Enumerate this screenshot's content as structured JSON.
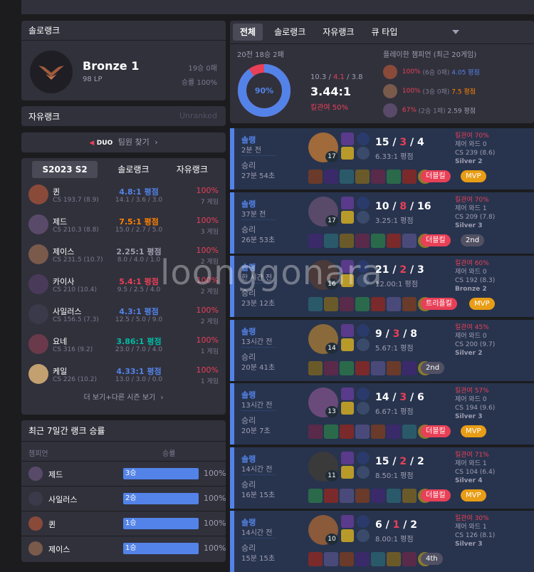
{
  "solo": {
    "title": "솔로랭크",
    "tier": "Bronze 1",
    "lp": "98 LP",
    "record": "19승 0패",
    "winrate": "승률 100%"
  },
  "flex": {
    "title": "자유랭크",
    "status": "Unranked"
  },
  "duo": {
    "badge": "DUO",
    "label": "팀원 찾기"
  },
  "season_tabs": [
    "S2023 S2",
    "솔로랭크",
    "자유랭크"
  ],
  "champions": [
    {
      "name": "퀸",
      "cs": "CS 193.7 (8.9)",
      "kda": "4.8:1 평점",
      "kda_color": "#5383e8",
      "stat": "14.1 / 3.6 / 3.0",
      "wr": "100%",
      "games": "7 게임"
    },
    {
      "name": "제드",
      "cs": "CS 210.3 (8.8)",
      "kda": "7.5:1 평점",
      "kda_color": "#ff8200",
      "stat": "15.0 / 2.7 / 5.0",
      "wr": "100%",
      "games": "3 게임"
    },
    {
      "name": "제이스",
      "cs": "CS 231.5 (10.7)",
      "kda": "2.25:1 평점",
      "kda_color": "#9e9eb1",
      "stat": "8.0 / 4.0 / 1.0",
      "wr": "100%",
      "games": "2 게임"
    },
    {
      "name": "카이사",
      "cs": "CS 210 (10.4)",
      "kda": "5.4:1 평점",
      "kda_color": "#e84057",
      "stat": "9.5 / 2.5 / 4.0",
      "wr": "100%",
      "games": "2 게임"
    },
    {
      "name": "사일러스",
      "cs": "CS 156.5 (7.3)",
      "kda": "4.3:1 평점",
      "kda_color": "#5383e8",
      "stat": "12.5 / 5.0 / 9.0",
      "wr": "100%",
      "games": "2 게임"
    },
    {
      "name": "요네",
      "cs": "CS 316 (9.2)",
      "kda": "3.86:1 평점",
      "kda_color": "#00bba3",
      "stat": "23.0 / 7.0 / 4.0",
      "wr": "100%",
      "games": "1 게임"
    },
    {
      "name": "케일",
      "cs": "CS 226 (10.2)",
      "kda": "4.33:1 평점",
      "kda_color": "#5383e8",
      "stat": "13.0 / 3.0 / 0.0",
      "wr": "100%",
      "games": "1 게임"
    }
  ],
  "more_label": "더 보기+다른 시즌 보기",
  "weekly": {
    "title": "최근 7일간 랭크 승률",
    "col_champ": "챔피언",
    "col_wr": "승률",
    "rows": [
      {
        "name": "제드",
        "wins": "3승",
        "pct": "100%"
      },
      {
        "name": "사일러스",
        "wins": "2승",
        "pct": "100%"
      },
      {
        "name": "퀸",
        "wins": "1승",
        "pct": "100%"
      },
      {
        "name": "제이스",
        "wins": "1승",
        "pct": "100%"
      }
    ]
  },
  "filter_tabs": [
    "전체",
    "솔로랭크",
    "자유랭크",
    "큐 타입"
  ],
  "summary": {
    "record": "20전 18승 2패",
    "donut_label": "90%",
    "win_fraction": 0.9,
    "kda_k": "10.3",
    "kda_d": "4.1",
    "kda_a": "3.8",
    "ratio": "3.44:1",
    "kp": "킬관여 50%",
    "played_title": "플레이한 챔피언 (최근 20게임)",
    "played": [
      {
        "wr": "100%",
        "detail": "(6승 0패)",
        "kda": "4.05 평점",
        "kda_color": "#5383e8"
      },
      {
        "wr": "100%",
        "detail": "(3승 0패)",
        "kda": "7.5 평점",
        "kda_color": "#ff8200"
      },
      {
        "wr": "67%",
        "detail": "(2승 1패)",
        "kda": "2.59 평점",
        "kda_color": "#9e9eb1"
      }
    ]
  },
  "matches": [
    {
      "type": "솔랭",
      "ago": "2분 전",
      "result": "승리",
      "duration": "27분 54초",
      "level": "17",
      "k": "15",
      "d": "3",
      "a": "4",
      "ratio": "6.33:1 평점",
      "kp": "킬관여 70%",
      "wards": "제어 와드 0",
      "cs": "CS 239 (8.6)",
      "rank": "Silver 2",
      "badges": [
        "더블킬",
        "MVP"
      ]
    },
    {
      "type": "솔랭",
      "ago": "37분 전",
      "result": "승리",
      "duration": "26분 53초",
      "level": "17",
      "k": "10",
      "d": "8",
      "a": "16",
      "ratio": "3.25:1 평점",
      "kp": "킬관여 70%",
      "wards": "제어 와드 1",
      "cs": "CS 209 (7.8)",
      "rank": "Silver 3",
      "badges": [
        "더블킬",
        "2nd"
      ]
    },
    {
      "type": "솔랭",
      "ago": "한 시간 전",
      "result": "승리",
      "duration": "23분 12초",
      "level": "16",
      "k": "21",
      "d": "2",
      "a": "3",
      "ratio": "12.00:1 평점",
      "kp": "킬관여 60%",
      "wards": "제어 와드 0",
      "cs": "CS 192 (8.3)",
      "rank": "Bronze 2",
      "badges": [
        "트리플킬",
        "MVP"
      ]
    },
    {
      "type": "솔랭",
      "ago": "13시간 전",
      "result": "승리",
      "duration": "20분 41초",
      "level": "14",
      "k": "9",
      "d": "3",
      "a": "8",
      "ratio": "5.67:1 평점",
      "kp": "킬관여 45%",
      "wards": "제어 와드 0",
      "cs": "CS 200 (9.7)",
      "rank": "Silver 2",
      "badges": [
        "2nd"
      ]
    },
    {
      "type": "솔랭",
      "ago": "13시간 전",
      "result": "승리",
      "duration": "20분 7초",
      "level": "13",
      "k": "14",
      "d": "3",
      "a": "6",
      "ratio": "6.67:1 평점",
      "kp": "킬관여 57%",
      "wards": "제어 와드 0",
      "cs": "CS 194 (9.6)",
      "rank": "Silver 3",
      "badges": [
        "더블킬",
        "MVP"
      ]
    },
    {
      "type": "솔랭",
      "ago": "14시간 전",
      "result": "승리",
      "duration": "16분 15초",
      "level": "11",
      "k": "15",
      "d": "2",
      "a": "2",
      "ratio": "8.50:1 평점",
      "kp": "킬관여 71%",
      "wards": "제어 와드 1",
      "cs": "CS 104 (6.4)",
      "rank": "Silver 4",
      "badges": [
        "더블킬",
        "MVP"
      ]
    },
    {
      "type": "솔랭",
      "ago": "14시간 전",
      "result": "승리",
      "duration": "15분 15초",
      "level": "10",
      "k": "6",
      "d": "1",
      "a": "2",
      "ratio": "8.00:1 평점",
      "kp": "킬관여 30%",
      "wards": "제어 와드 1",
      "cs": "CS 126 (8.1)",
      "rank": "Silver 3",
      "badges": [
        "4th"
      ]
    }
  ],
  "colors": {
    "bg": "#1c1c1f",
    "panel": "#31313c",
    "win": "#5383e8",
    "win_bg": "#28344e",
    "loss": "#e84057",
    "orange": "#e89d16",
    "red_badge": "#e84057",
    "gray_badge": "#515163"
  }
}
